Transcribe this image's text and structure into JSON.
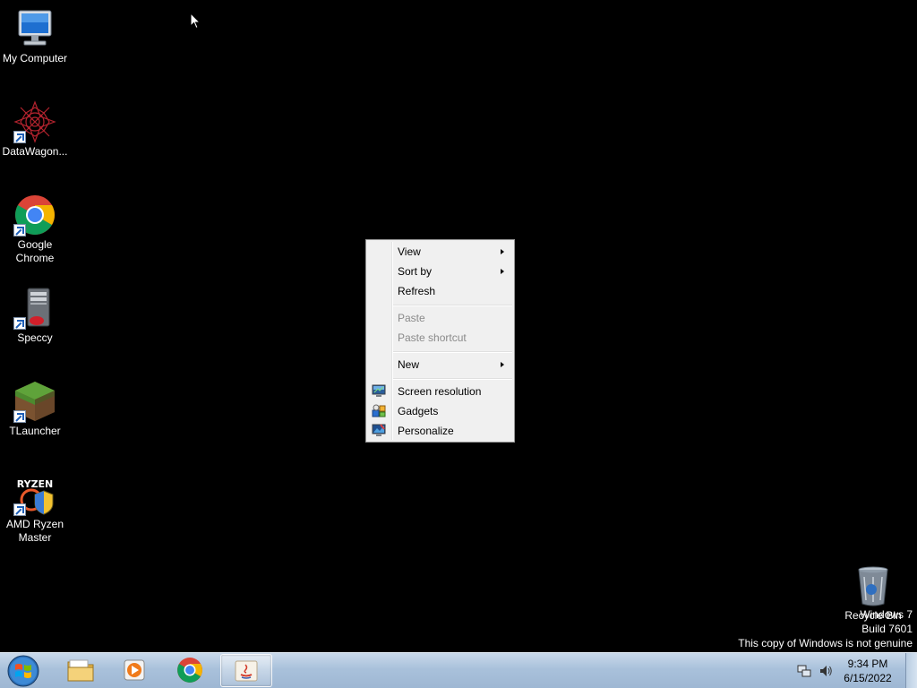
{
  "desktop_icons": [
    {
      "label": "My Computer",
      "icon": "computer-icon"
    },
    {
      "label": "DataWagon...",
      "icon": "datawagon-icon"
    },
    {
      "label": "Google Chrome",
      "icon": "chrome-icon"
    },
    {
      "label": "Speccy",
      "icon": "speccy-icon"
    },
    {
      "label": "TLauncher",
      "icon": "tlauncher-icon"
    },
    {
      "label": "AMD Ryzen Master",
      "icon": "ryzen-master-icon"
    },
    {
      "label": "Recycle Bin",
      "icon": "recycle-bin-icon"
    }
  ],
  "context_menu": {
    "items": [
      {
        "label": "View",
        "submenu": true,
        "enabled": true
      },
      {
        "label": "Sort by",
        "submenu": true,
        "enabled": true
      },
      {
        "label": "Refresh",
        "submenu": false,
        "enabled": true
      },
      {
        "label": "Paste",
        "submenu": false,
        "enabled": false
      },
      {
        "label": "Paste shortcut",
        "submenu": false,
        "enabled": false
      },
      {
        "label": "New",
        "submenu": true,
        "enabled": true
      },
      {
        "label": "Screen resolution",
        "submenu": false,
        "enabled": true,
        "icon": "screen-resolution-icon"
      },
      {
        "label": "Gadgets",
        "submenu": false,
        "enabled": true,
        "icon": "gadgets-icon"
      },
      {
        "label": "Personalize",
        "submenu": false,
        "enabled": true,
        "icon": "personalize-icon"
      }
    ]
  },
  "watermark": {
    "line1": "Windows 7",
    "line2": "Build 7601",
    "line3": "This copy of Windows is not genuine"
  },
  "taskbar": {
    "pinned": [
      {
        "name": "windows-explorer",
        "icon": "folder-icon"
      },
      {
        "name": "media-player",
        "icon": "media-player-icon"
      },
      {
        "name": "google-chrome",
        "icon": "chrome-icon"
      },
      {
        "name": "java",
        "icon": "java-icon",
        "active": true
      }
    ],
    "clock": {
      "time": "9:34 PM",
      "date": "6/15/2022"
    }
  },
  "colors": {
    "desktop_bg": "#000000",
    "menu_bg": "#f0f0f0",
    "disabled_text": "#8a8a8a",
    "taskbar_top": "#c9d9ea",
    "taskbar_bottom": "#9eb7d3"
  }
}
